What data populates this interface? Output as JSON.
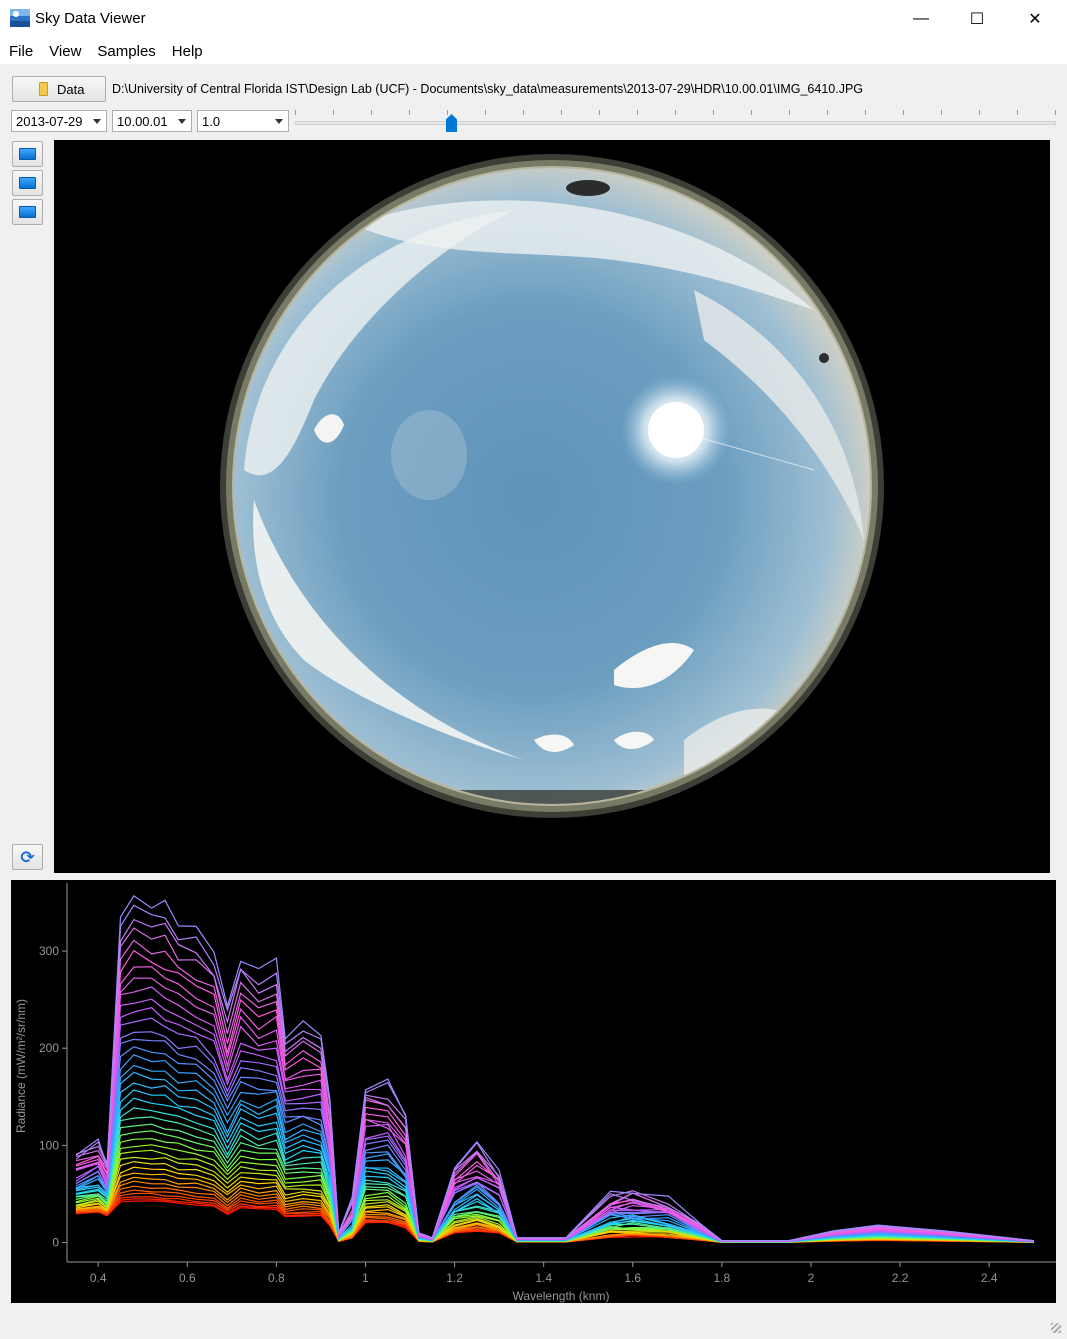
{
  "window": {
    "title": "Sky Data Viewer",
    "minimize": "—",
    "maximize": "☐",
    "close": "✕"
  },
  "menu": [
    "File",
    "View",
    "Samples",
    "Help"
  ],
  "toolbar": {
    "data_button_label": "Data",
    "path": "D:\\University of Central Florida IST\\Design Lab (UCF) - Documents\\sky_data\\measurements\\2013-07-29\\HDR\\10.00.01\\IMG_6410.JPG",
    "date_selected": "2013-07-29",
    "time_selected": "10.00.01",
    "exposure_selected": "1.0",
    "slider_position_fraction": 0.205,
    "slider_tick_count": 20
  },
  "side_buttons": [
    "monitor-icon",
    "monitor-icon",
    "monitor-icon"
  ],
  "refresh_icon": "refresh-icon",
  "chart_data": {
    "type": "line",
    "xlabel": "Wavelength (knm)",
    "ylabel": "Radiance (mW/m²/sr/nm)",
    "xlim": [
      0.33,
      2.55
    ],
    "ylim": [
      -20,
      370
    ],
    "xticks": [
      "0.4",
      "0.6",
      "0.8",
      "1",
      "1.2",
      "1.4",
      "1.6",
      "1.8",
      "2",
      "2.2",
      "2.4"
    ],
    "yticks": [
      "0",
      "100",
      "200",
      "300"
    ],
    "grid": false,
    "background": "#000000",
    "series_count": 40,
    "colors": [
      "#ff0000",
      "#ff5a00",
      "#ffd000",
      "#7cff3a",
      "#22d6ff",
      "#3aa0ff",
      "#c05cff",
      "#ff5adc",
      "#9c8cff"
    ],
    "series_max_peak": [
      {
        "x": 0.35,
        "y": 130
      },
      {
        "x": 0.4,
        "y": 150
      },
      {
        "x": 0.42,
        "y": 115
      },
      {
        "x": 0.45,
        "y": 340
      },
      {
        "x": 0.48,
        "y": 355
      },
      {
        "x": 0.52,
        "y": 350
      },
      {
        "x": 0.55,
        "y": 345
      },
      {
        "x": 0.58,
        "y": 330
      },
      {
        "x": 0.62,
        "y": 320
      },
      {
        "x": 0.66,
        "y": 300
      },
      {
        "x": 0.69,
        "y": 240
      },
      {
        "x": 0.72,
        "y": 295
      },
      {
        "x": 0.76,
        "y": 280
      },
      {
        "x": 0.8,
        "y": 285
      },
      {
        "x": 0.82,
        "y": 215
      },
      {
        "x": 0.86,
        "y": 225
      },
      {
        "x": 0.9,
        "y": 220
      },
      {
        "x": 0.92,
        "y": 145
      },
      {
        "x": 0.94,
        "y": 10
      },
      {
        "x": 0.97,
        "y": 40
      },
      {
        "x": 1.0,
        "y": 165
      },
      {
        "x": 1.05,
        "y": 165
      },
      {
        "x": 1.09,
        "y": 130
      },
      {
        "x": 1.12,
        "y": 10
      },
      {
        "x": 1.15,
        "y": 5
      },
      {
        "x": 1.2,
        "y": 80
      },
      {
        "x": 1.25,
        "y": 100
      },
      {
        "x": 1.3,
        "y": 75
      },
      {
        "x": 1.34,
        "y": 5
      },
      {
        "x": 1.45,
        "y": 5
      },
      {
        "x": 1.55,
        "y": 50
      },
      {
        "x": 1.6,
        "y": 52
      },
      {
        "x": 1.68,
        "y": 45
      },
      {
        "x": 1.75,
        "y": 20
      },
      {
        "x": 1.8,
        "y": 2
      },
      {
        "x": 1.95,
        "y": 2
      },
      {
        "x": 2.05,
        "y": 12
      },
      {
        "x": 2.15,
        "y": 18
      },
      {
        "x": 2.3,
        "y": 12
      },
      {
        "x": 2.5,
        "y": 2
      }
    ]
  }
}
